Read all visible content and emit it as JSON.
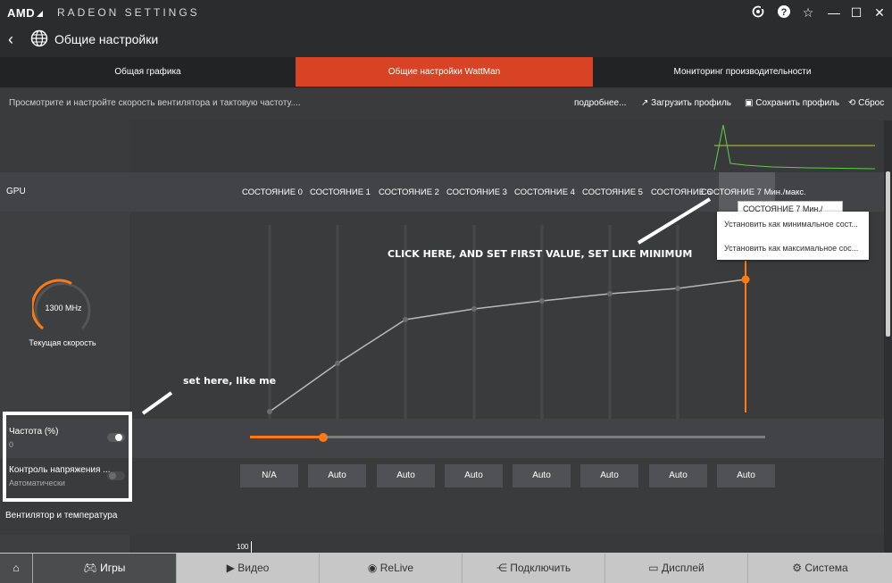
{
  "titlebar": {
    "logo": "AMD",
    "app_title": "RADEON SETTINGS",
    "icons": [
      "update-icon",
      "help-icon",
      "favorite-icon",
      "minimize-icon",
      "maximize-icon",
      "close-icon"
    ]
  },
  "header": {
    "title": "Общие настройки"
  },
  "tabs": [
    {
      "label": "Общая графика",
      "active": false
    },
    {
      "label": "Общие настройки WattMan",
      "active": true
    },
    {
      "label": "Мониторинг производительности",
      "active": false
    }
  ],
  "toolbar": {
    "description": "Просмотрите и настройте скорость вентилятора и тактовую частоту....",
    "more": "подробнее...",
    "load_profile": "Загрузить профиль",
    "save_profile": "Сохранить профиль",
    "reset": "Сброс"
  },
  "gpu": {
    "label": "GPU",
    "states": [
      "СОСТОЯНИЕ 0",
      "СОСТОЯНИЕ 1",
      "СОСТОЯНИЕ 2",
      "СОСТОЯНИЕ 3",
      "СОСТОЯНИЕ 4",
      "СОСТОЯНИЕ 5",
      "СОСТОЯНИЕ 6",
      "СОСТОЯНИЕ 7 Мин./макс."
    ],
    "tooltip": "СОСТОЯНИЕ 7 Мин./макс.",
    "menu": [
      "Установить как минимальное сост...",
      "Установить как максимальное сос..."
    ]
  },
  "gauge": {
    "value": "1300 MHz",
    "label": "Текущая скорость",
    "fraction": 0.55
  },
  "frequency": {
    "label": "Частота (%)",
    "value": "0",
    "slider_fraction": 0.14
  },
  "voltage": {
    "label": "Контроль напряжения ...",
    "value": "Автоматически",
    "states": [
      "N/A",
      "Auto",
      "Auto",
      "Auto",
      "Auto",
      "Auto",
      "Auto",
      "Auto"
    ]
  },
  "fan": {
    "label": "Вентилятор и температура",
    "axis_tick": "100"
  },
  "annotations": {
    "click_here": "CLICK HERE, AND SET FIRST VALUE, SET LIKE MINIMUM",
    "set_here": "set here, like me"
  },
  "bottom_nav": [
    {
      "label": "",
      "icon": "home-icon"
    },
    {
      "label": "Игры",
      "icon": "gamepad-icon"
    },
    {
      "label": "Видео",
      "icon": "play-icon"
    },
    {
      "label": "ReLive",
      "icon": "relive-icon"
    },
    {
      "label": "Подключить",
      "icon": "share-icon"
    },
    {
      "label": "Дисплей",
      "icon": "monitor-icon"
    },
    {
      "label": "Система",
      "icon": "settings-icon"
    }
  ],
  "colors": {
    "accent": "#d84326",
    "orange": "#ff7a12"
  }
}
